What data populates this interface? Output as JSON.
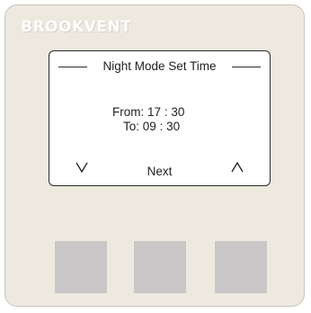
{
  "brand": {
    "name": "BROOKVENT"
  },
  "display": {
    "title": "Night Mode Set Time",
    "from": {
      "label": "From:",
      "hours": "17",
      "separator": ":",
      "minutes": "30"
    },
    "to": {
      "label": "To:",
      "hours": "09",
      "separator": ":",
      "minutes": "30"
    },
    "softkeys": {
      "left_icon": "chevron-down-icon",
      "center_label": "Next",
      "right_icon": "chevron-up-icon"
    }
  },
  "buttons": [
    {
      "name": "left-button"
    },
    {
      "name": "middle-button"
    },
    {
      "name": "right-button"
    }
  ],
  "colors": {
    "panel": "#eee9df",
    "button": "#c9c7c7",
    "screen": "#ffffff",
    "screen_border": "#2a2a2a"
  }
}
